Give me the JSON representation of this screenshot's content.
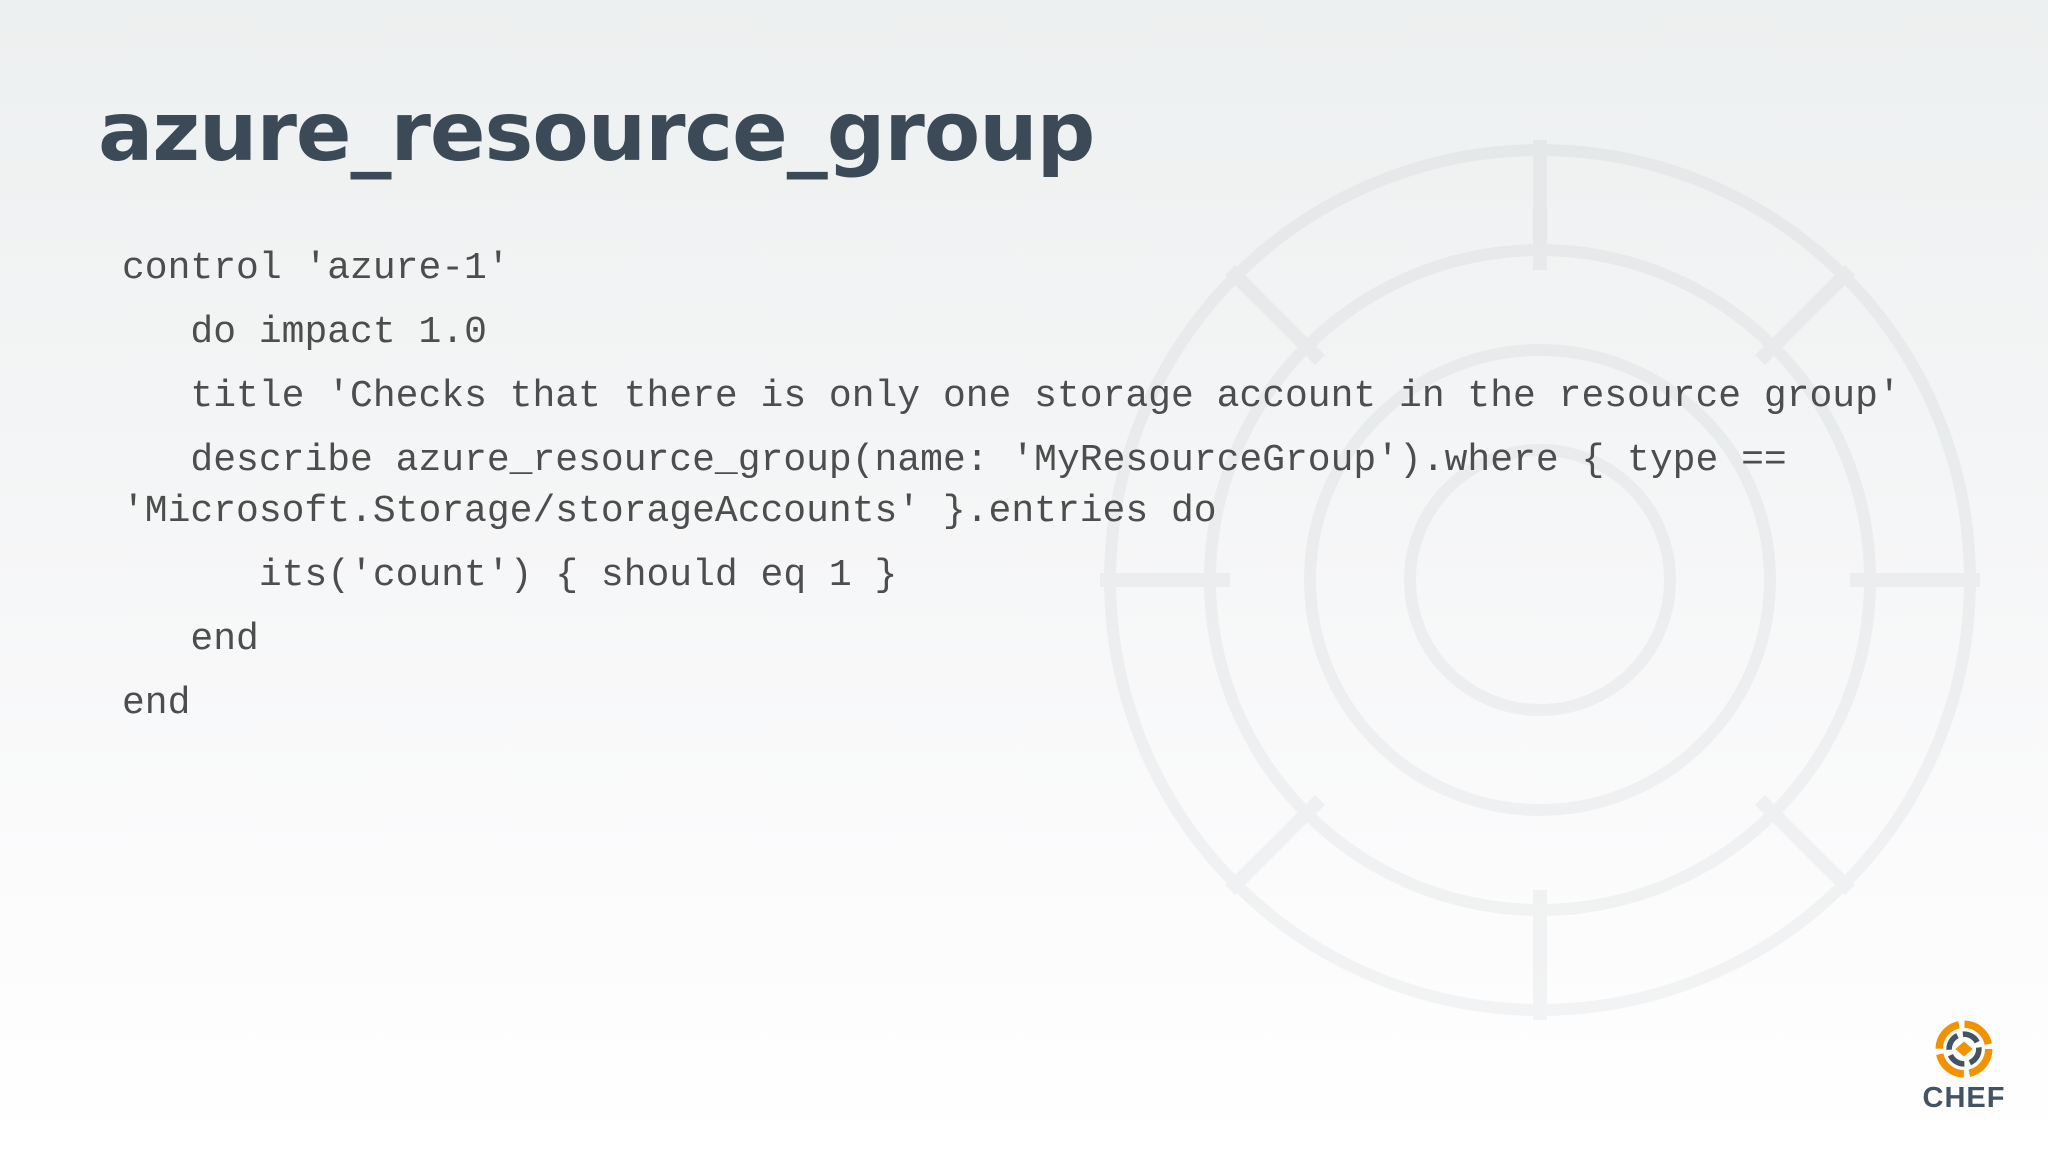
{
  "slide": {
    "title": "azure_resource_group"
  },
  "code": {
    "lines": [
      "control 'azure-1'",
      "   do impact 1.0",
      "   title 'Checks that there is only one storage account in the resource group'",
      "   describe azure_resource_group(name: 'MyResourceGroup').where { type == 'Microsoft.Storage/storageAccounts' }.entries do",
      "      its('count') { should eq 1 }",
      "   end",
      "end"
    ]
  },
  "logo": {
    "text": "CHEF",
    "icon": "chef-logo-icon",
    "colors": {
      "orange": "#f39200",
      "slate": "#435363"
    }
  },
  "colors": {
    "title": "#3c4a57",
    "code": "#4d4d4d"
  }
}
